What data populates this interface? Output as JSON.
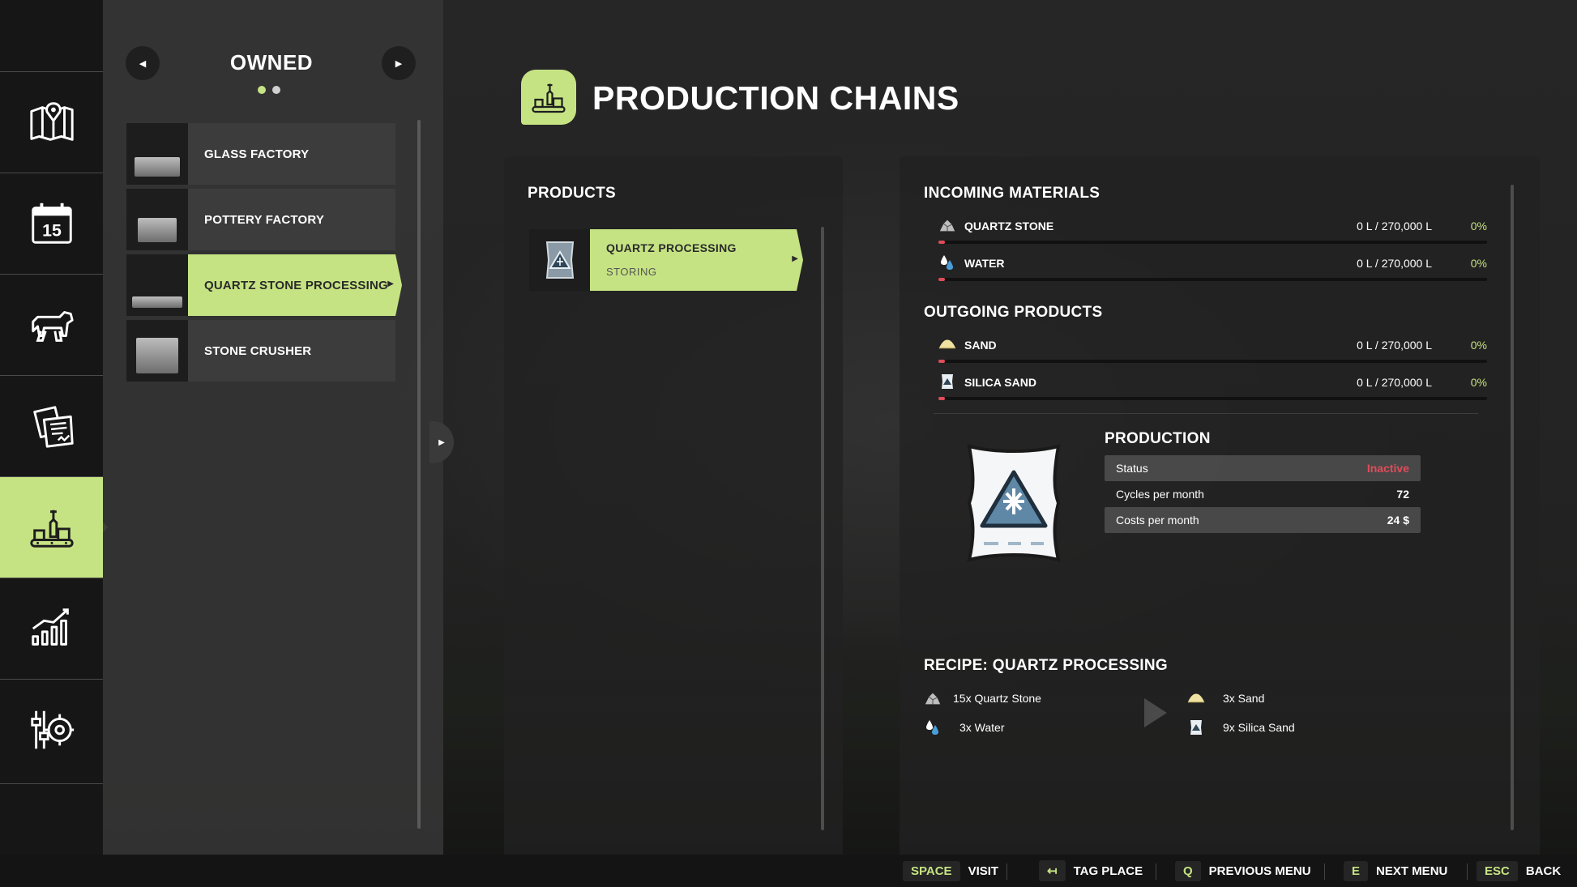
{
  "owned_panel": {
    "title": "OWNED",
    "prev_label": "◀",
    "next_label": "▶",
    "pages": 2,
    "current_page": 1,
    "items": [
      {
        "label": "GLASS FACTORY",
        "selected": false
      },
      {
        "label": "POTTERY FACTORY",
        "selected": false
      },
      {
        "label": "QUARTZ STONE PROCESSING",
        "selected": true
      },
      {
        "label": "STONE CRUSHER",
        "selected": false
      }
    ]
  },
  "nav_rail": {
    "items": [
      {
        "icon": "map-icon"
      },
      {
        "icon": "calendar-icon",
        "badge": "15"
      },
      {
        "icon": "animals-icon"
      },
      {
        "icon": "contracts-icon"
      },
      {
        "icon": "production-icon",
        "active": true
      },
      {
        "icon": "statistics-icon"
      },
      {
        "icon": "settings-icon"
      }
    ]
  },
  "header": {
    "title": "PRODUCTION CHAINS",
    "icon": "production-chain-icon"
  },
  "products": {
    "title": "PRODUCTS",
    "items": [
      {
        "name": "QUARTZ PROCESSING",
        "status": "STORING",
        "icon": "silica-bag-icon"
      }
    ]
  },
  "incoming": {
    "title": "INCOMING MATERIALS",
    "items": [
      {
        "name": "QUARTZ STONE",
        "amount": "0 L / 270,000 L",
        "percent": "0%",
        "fill": 0,
        "icon": "quartz-stone-icon"
      },
      {
        "name": "WATER",
        "amount": "0 L / 270,000 L",
        "percent": "0%",
        "fill": 0,
        "icon": "water-icon"
      }
    ]
  },
  "outgoing": {
    "title": "OUTGOING PRODUCTS",
    "items": [
      {
        "name": "SAND",
        "amount": "0 L / 270,000 L",
        "percent": "0%",
        "fill": 0,
        "icon": "sand-icon"
      },
      {
        "name": "SILICA SAND",
        "amount": "0 L / 270,000 L",
        "percent": "0%",
        "fill": 0,
        "icon": "silica-sand-icon"
      }
    ]
  },
  "production": {
    "title": "PRODUCTION",
    "rows": [
      {
        "label": "Status",
        "value": "Inactive"
      },
      {
        "label": "Cycles per month",
        "value": "72"
      },
      {
        "label": "Costs per month",
        "value": "24 $"
      }
    ]
  },
  "recipe": {
    "title": "RECIPE: QUARTZ PROCESSING",
    "inputs": [
      {
        "text": "15x Quartz Stone",
        "icon": "quartz-stone-icon"
      },
      {
        "text": "3x Water",
        "icon": "water-icon"
      }
    ],
    "outputs": [
      {
        "text": "3x Sand",
        "icon": "sand-icon"
      },
      {
        "text": "9x Silica Sand",
        "icon": "silica-sand-icon"
      }
    ]
  },
  "footer": {
    "actions": [
      {
        "key": "SPACE",
        "label": "VISIT"
      },
      {
        "key": "↤",
        "label": "TAG PLACE"
      },
      {
        "key": "Q",
        "label": "PREVIOUS MENU"
      },
      {
        "key": "E",
        "label": "NEXT MENU"
      },
      {
        "key": "ESC",
        "label": "BACK"
      }
    ]
  },
  "colors": {
    "accent": "#c6e383",
    "warning": "#e04c5a",
    "panel": "#343434",
    "rail": "#161616"
  }
}
